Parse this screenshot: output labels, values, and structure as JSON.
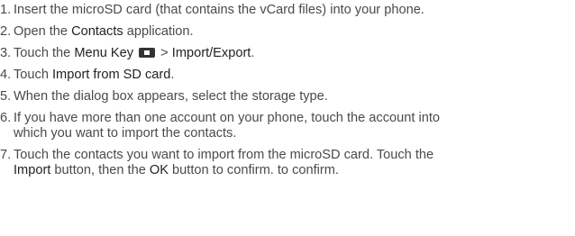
{
  "steps": [
    {
      "number": "1.",
      "text": "Insert the microSD card (that contains the vCard files) into your phone."
    },
    {
      "number": "2.",
      "pre": "Open the ",
      "bold": "Contacts",
      "post": " application."
    },
    {
      "number": "3.",
      "pre": "Touch the ",
      "bold": "Menu Key",
      "icon": "menu-key-icon",
      "sep": " > ",
      "bold2": "Import/Export",
      "post": "."
    },
    {
      "number": "4.",
      "pre": "Touch ",
      "bold": "Import from SD card",
      "post": "."
    },
    {
      "number": "5.",
      "text": "When the dialog box appears, select the storage type."
    },
    {
      "number": "6.",
      "line1": "If you have more than one account on your phone, touch the account into",
      "line2": "which you want to import the contacts."
    },
    {
      "number": "7.",
      "line1": "Touch the contacts you want to import from the microSD card. Touch the",
      "bold": "Import",
      "mid": " button, then the ",
      "bold2": "OK",
      "post": " button to confirm. to confirm."
    }
  ]
}
